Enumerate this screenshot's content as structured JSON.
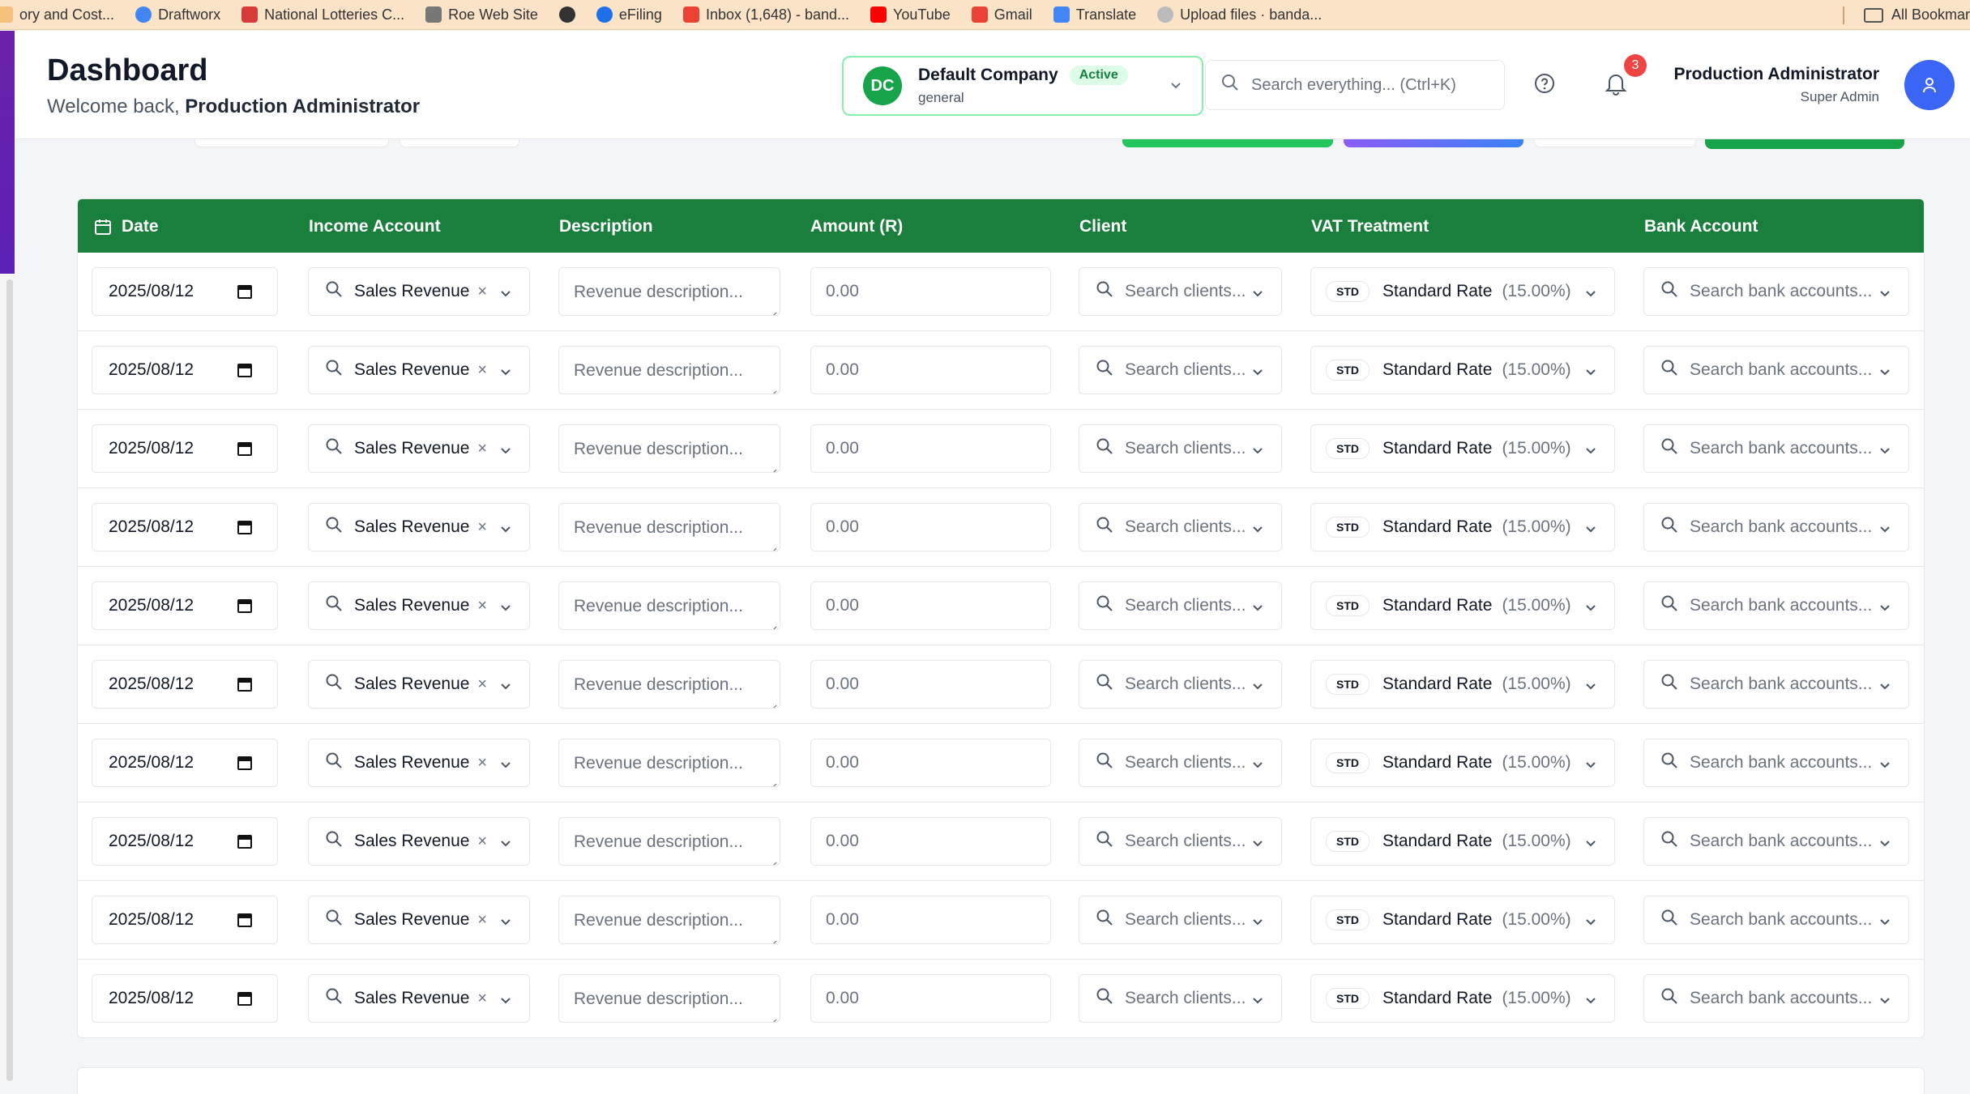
{
  "bookmarks": {
    "items": [
      {
        "label": "ory and Cost...",
        "icon": "doc-icon",
        "color": "#f4c07a"
      },
      {
        "label": "Draftworx",
        "icon": "chrome-icon",
        "color": "#4285f4"
      },
      {
        "label": "National Lotteries C...",
        "icon": "flag-icon",
        "color": "#d63b3b"
      },
      {
        "label": "Roe Web Site",
        "icon": "image-icon",
        "color": "#777777"
      },
      {
        "label": "",
        "icon": "globe-icon",
        "color": "#333333"
      },
      {
        "label": "eFiling",
        "icon": "efiling-icon",
        "color": "#1f6feb"
      },
      {
        "label": "Inbox (1,648) - band...",
        "icon": "gmail-icon",
        "color": "#ea4335"
      },
      {
        "label": "YouTube",
        "icon": "youtube-icon",
        "color": "#ff0000"
      },
      {
        "label": "Gmail",
        "icon": "gmail-icon",
        "color": "#ea4335"
      },
      {
        "label": "Translate",
        "icon": "translate-icon",
        "color": "#4285f4"
      },
      {
        "label": "Upload files · banda...",
        "icon": "upload-icon",
        "color": "#bbbbbb"
      }
    ],
    "all_bookmarks": "All Bookmar"
  },
  "header": {
    "title": "Dashboard",
    "welcome_prefix": "Welcome back, ",
    "welcome_name": "Production Administrator",
    "company": {
      "initials": "DC",
      "name": "Default Company",
      "status": "Active",
      "type": "general"
    },
    "search_placeholder": "Search everything... (Ctrl+K)",
    "notification_count": "3",
    "user": {
      "name": "Production Administrator",
      "role": "Super Admin"
    }
  },
  "table": {
    "columns": {
      "date": "Date",
      "income_account": "Income Account",
      "description": "Description",
      "amount": "Amount (R)",
      "client": "Client",
      "vat_treatment": "VAT Treatment",
      "bank_account": "Bank Account"
    },
    "rows": [
      {
        "date": "2025/08/12",
        "income_account": "Sales Revenue",
        "description_placeholder": "Revenue description...",
        "amount": "0.00",
        "client_placeholder": "Search clients...",
        "vat_code": "STD",
        "vat_label": "Standard Rate",
        "vat_rate": "(15.00%)",
        "bank_placeholder": "Search bank accounts..."
      },
      {
        "date": "2025/08/12",
        "income_account": "Sales Revenue",
        "description_placeholder": "Revenue description...",
        "amount": "0.00",
        "client_placeholder": "Search clients...",
        "vat_code": "STD",
        "vat_label": "Standard Rate",
        "vat_rate": "(15.00%)",
        "bank_placeholder": "Search bank accounts..."
      },
      {
        "date": "2025/08/12",
        "income_account": "Sales Revenue",
        "description_placeholder": "Revenue description...",
        "amount": "0.00",
        "client_placeholder": "Search clients...",
        "vat_code": "STD",
        "vat_label": "Standard Rate",
        "vat_rate": "(15.00%)",
        "bank_placeholder": "Search bank accounts..."
      },
      {
        "date": "2025/08/12",
        "income_account": "Sales Revenue",
        "description_placeholder": "Revenue description...",
        "amount": "0.00",
        "client_placeholder": "Search clients...",
        "vat_code": "STD",
        "vat_label": "Standard Rate",
        "vat_rate": "(15.00%)",
        "bank_placeholder": "Search bank accounts..."
      },
      {
        "date": "2025/08/12",
        "income_account": "Sales Revenue",
        "description_placeholder": "Revenue description...",
        "amount": "0.00",
        "client_placeholder": "Search clients...",
        "vat_code": "STD",
        "vat_label": "Standard Rate",
        "vat_rate": "(15.00%)",
        "bank_placeholder": "Search bank accounts..."
      },
      {
        "date": "2025/08/12",
        "income_account": "Sales Revenue",
        "description_placeholder": "Revenue description...",
        "amount": "0.00",
        "client_placeholder": "Search clients...",
        "vat_code": "STD",
        "vat_label": "Standard Rate",
        "vat_rate": "(15.00%)",
        "bank_placeholder": "Search bank accounts..."
      },
      {
        "date": "2025/08/12",
        "income_account": "Sales Revenue",
        "description_placeholder": "Revenue description...",
        "amount": "0.00",
        "client_placeholder": "Search clients...",
        "vat_code": "STD",
        "vat_label": "Standard Rate",
        "vat_rate": "(15.00%)",
        "bank_placeholder": "Search bank accounts..."
      },
      {
        "date": "2025/08/12",
        "income_account": "Sales Revenue",
        "description_placeholder": "Revenue description...",
        "amount": "0.00",
        "client_placeholder": "Search clients...",
        "vat_code": "STD",
        "vat_label": "Standard Rate",
        "vat_rate": "(15.00%)",
        "bank_placeholder": "Search bank accounts..."
      },
      {
        "date": "2025/08/12",
        "income_account": "Sales Revenue",
        "description_placeholder": "Revenue description...",
        "amount": "0.00",
        "client_placeholder": "Search clients...",
        "vat_code": "STD",
        "vat_label": "Standard Rate",
        "vat_rate": "(15.00%)",
        "bank_placeholder": "Search bank accounts..."
      },
      {
        "date": "2025/08/12",
        "income_account": "Sales Revenue",
        "description_placeholder": "Revenue description...",
        "amount": "0.00",
        "client_placeholder": "Search clients...",
        "vat_code": "STD",
        "vat_label": "Standard Rate",
        "vat_rate": "(15.00%)",
        "bank_placeholder": "Search bank accounts..."
      }
    ]
  },
  "colors": {
    "table_header": "#1a7f3c",
    "company_border": "#86efac",
    "company_logo": "#16a34a",
    "avatar": "#3b66f5",
    "badge": "#ef4444",
    "bookmarks_bar": "#fbe3c8"
  }
}
